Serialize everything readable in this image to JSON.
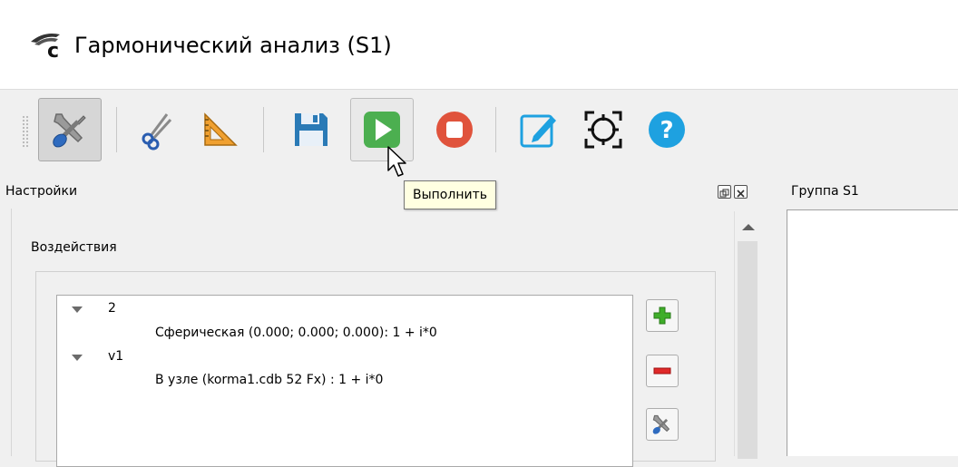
{
  "window": {
    "title": "Гармонический анализ (S1)"
  },
  "toolbar": {
    "buttons": [
      {
        "icon": "settings-tools-icon",
        "state": "pressed"
      },
      {
        "icon": "scissors-icon"
      },
      {
        "icon": "ruler-triangle-icon"
      },
      {
        "icon": "save-icon"
      },
      {
        "icon": "play-icon",
        "state": "hover"
      },
      {
        "icon": "stop-icon"
      },
      {
        "icon": "edit-icon"
      },
      {
        "icon": "target-icon"
      },
      {
        "icon": "help-icon"
      }
    ],
    "tooltip": "Выполнить"
  },
  "settings_panel": {
    "title": "Настройки",
    "section": "Воздействия",
    "tree": [
      {
        "label": "2",
        "child": "Сферическая (0.000; 0.000; 0.000): 1 + i*0"
      },
      {
        "label": "v1",
        "child": "В узле (korma1.cdb 52 Fx) : 1 + i*0"
      }
    ],
    "side_buttons": [
      "add-icon",
      "remove-icon",
      "settings-tools-icon"
    ]
  },
  "group_panel": {
    "title": "Группа S1"
  },
  "colors": {
    "play_green": "#4caf50",
    "stop_red": "#e0533c",
    "help_blue": "#1ea1e0",
    "save_blue": "#2a7ab6",
    "tooltip_bg": "#ffffe1"
  }
}
